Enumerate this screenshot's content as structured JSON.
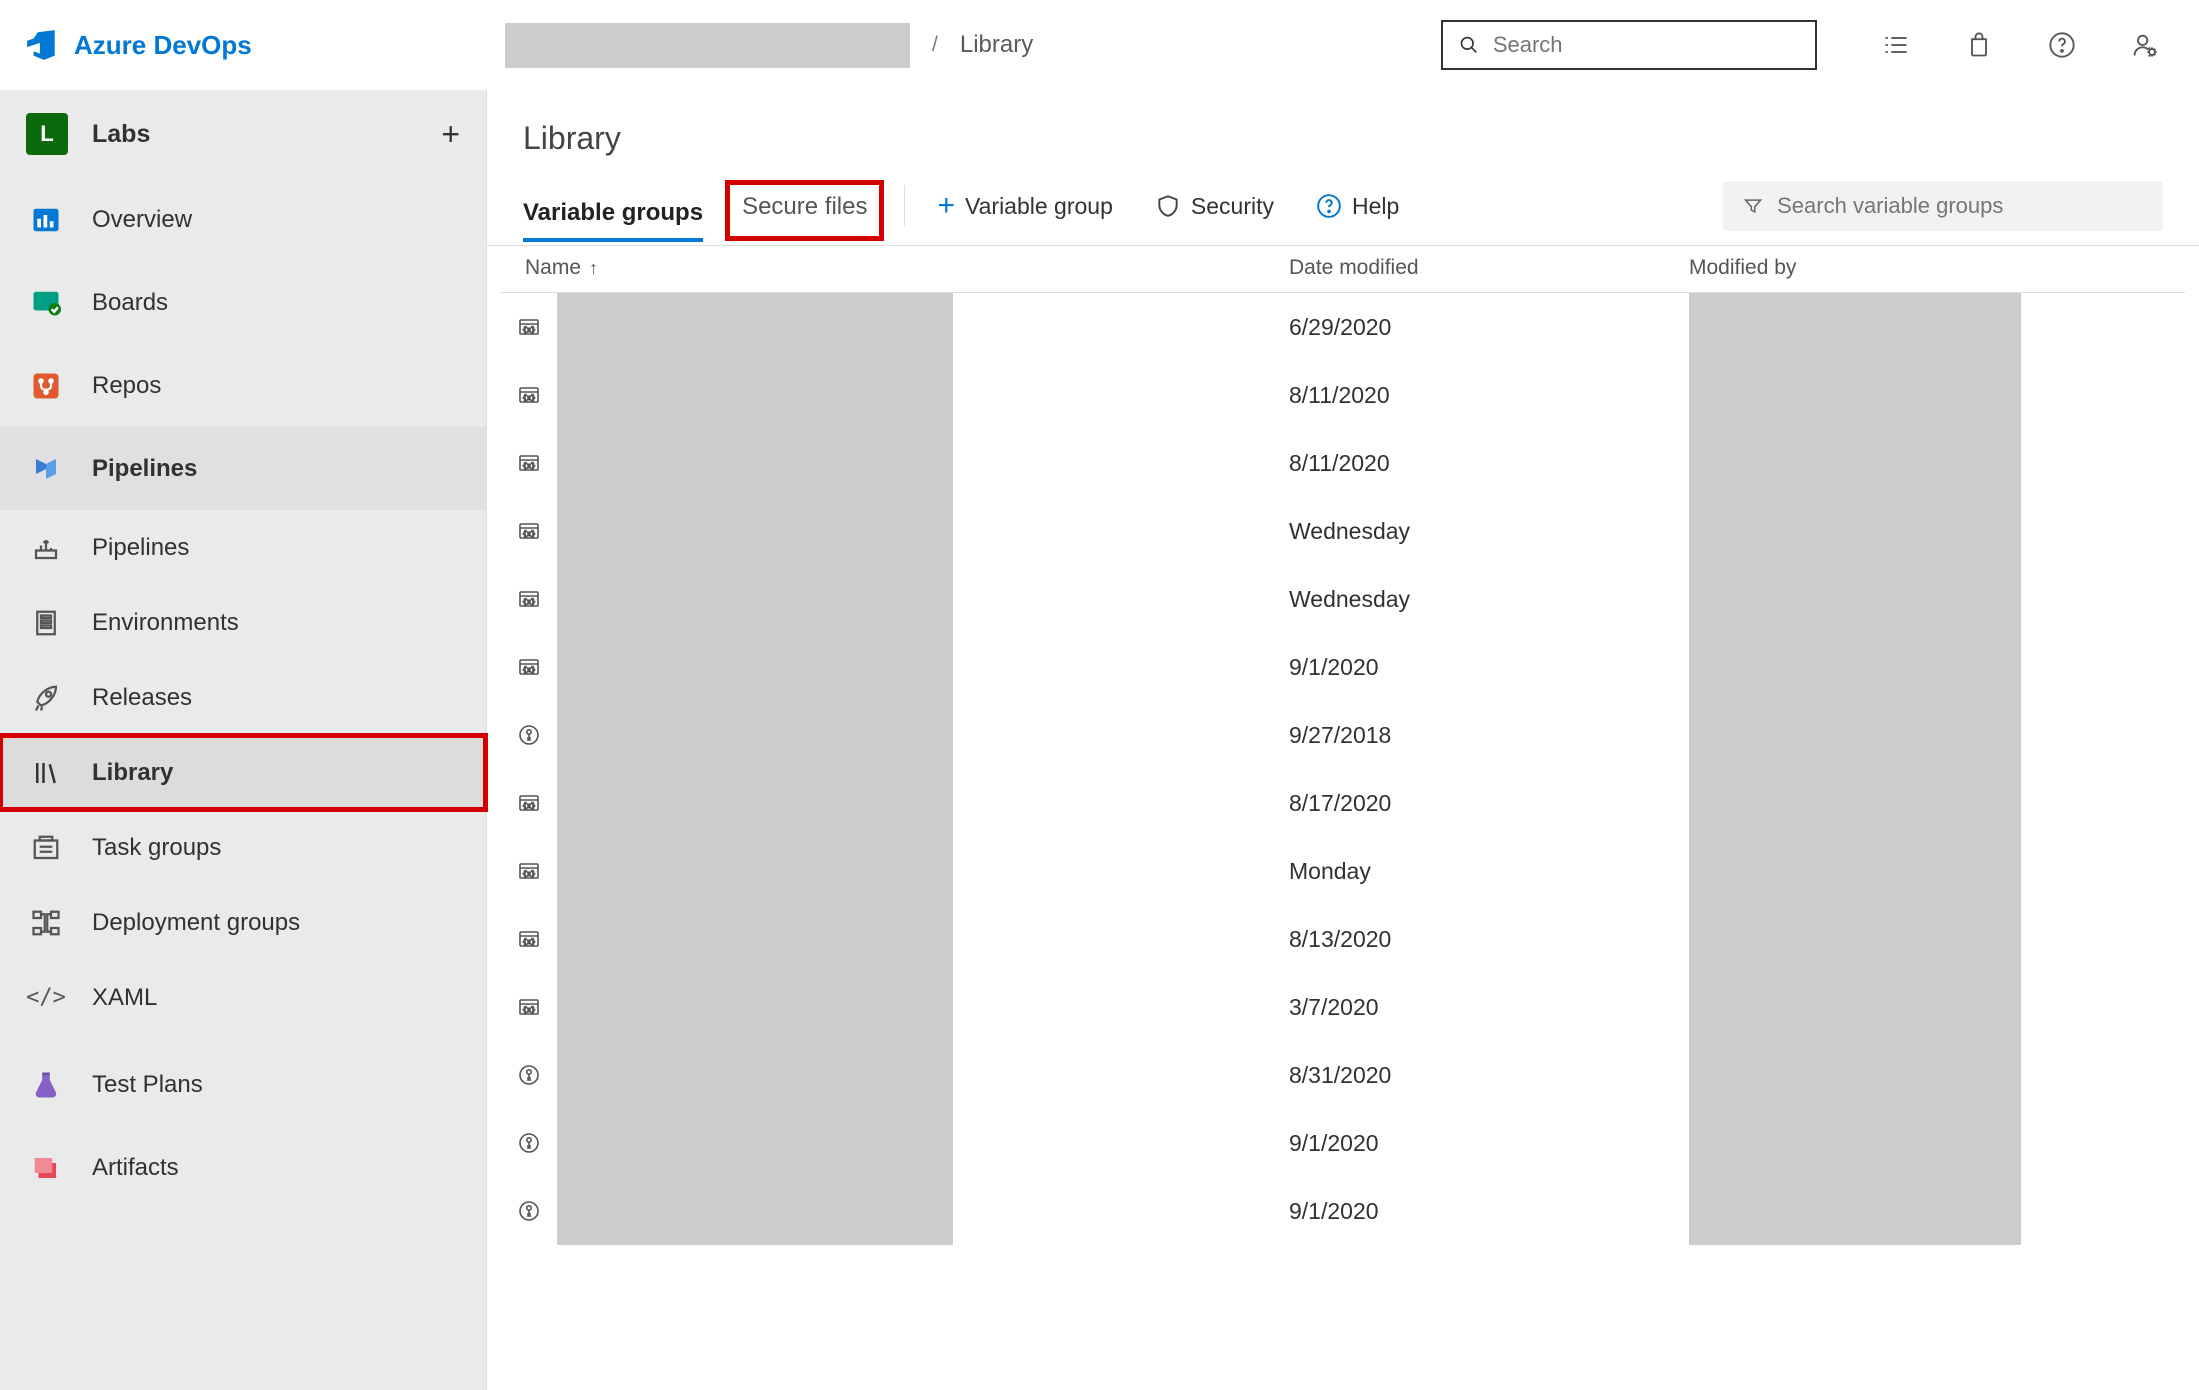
{
  "brand": "Azure DevOps",
  "breadcrumb": {
    "current": "Library"
  },
  "search": {
    "placeholder": "Search"
  },
  "project": {
    "badge": "L",
    "name": "Labs"
  },
  "nav": {
    "overview": "Overview",
    "boards": "Boards",
    "repos": "Repos",
    "pipelines_group": "Pipelines",
    "pipelines": "Pipelines",
    "environments": "Environments",
    "releases": "Releases",
    "library": "Library",
    "task_groups": "Task groups",
    "deployment_groups": "Deployment groups",
    "xaml": "XAML",
    "test_plans": "Test Plans",
    "artifacts": "Artifacts"
  },
  "page": {
    "title": "Library"
  },
  "tabs": {
    "variable_groups": "Variable groups",
    "secure_files": "Secure files"
  },
  "actions": {
    "variable_group": "Variable group",
    "security": "Security",
    "help": "Help"
  },
  "filter": {
    "placeholder": "Search variable groups"
  },
  "columns": {
    "name": "Name",
    "date": "Date modified",
    "modified_by": "Modified by"
  },
  "rows": [
    {
      "icon": "vg",
      "date": "6/29/2020"
    },
    {
      "icon": "vg",
      "date": "8/11/2020"
    },
    {
      "icon": "vg",
      "date": "8/11/2020"
    },
    {
      "icon": "vg",
      "date": "Wednesday"
    },
    {
      "icon": "vg",
      "date": "Wednesday"
    },
    {
      "icon": "vg",
      "date": "9/1/2020"
    },
    {
      "icon": "kv",
      "date": "9/27/2018"
    },
    {
      "icon": "vg",
      "date": "8/17/2020"
    },
    {
      "icon": "vg",
      "date": "Monday"
    },
    {
      "icon": "vg",
      "date": "8/13/2020"
    },
    {
      "icon": "vg",
      "date": "3/7/2020"
    },
    {
      "icon": "kv",
      "date": "8/31/2020"
    },
    {
      "icon": "kv",
      "date": "9/1/2020"
    },
    {
      "icon": "kv",
      "date": "9/1/2020"
    }
  ]
}
